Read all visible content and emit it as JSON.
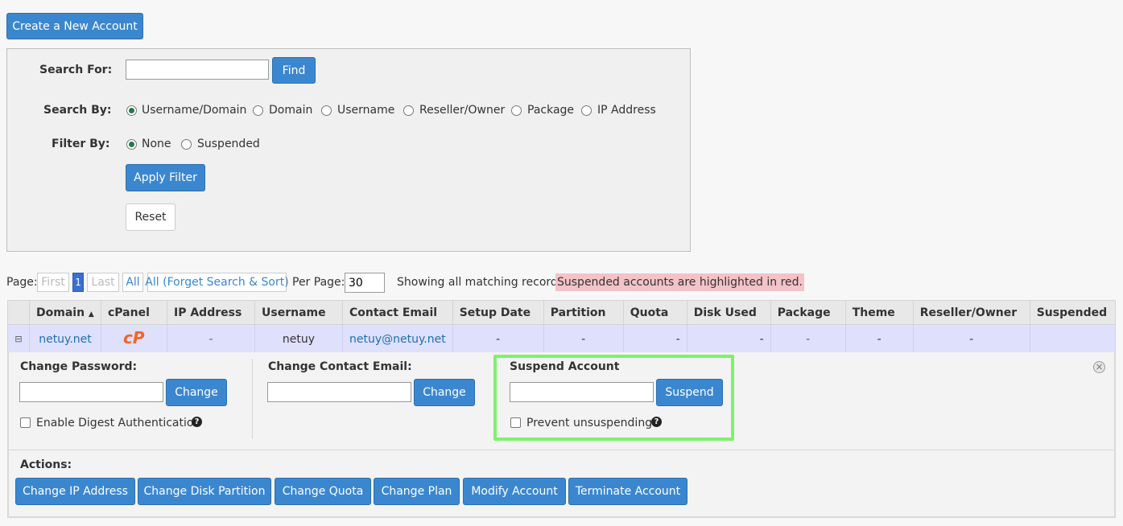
{
  "top": {
    "create_label": "Create a New Account"
  },
  "search": {
    "search_for_label": "Search For:",
    "search_value": "",
    "find_label": "Find",
    "search_by_label": "Search By:",
    "search_by_options": [
      "Username/Domain",
      "Domain",
      "Username",
      "Reseller/Owner",
      "Package",
      "IP Address"
    ],
    "search_by_selected": "Username/Domain",
    "filter_by_label": "Filter By:",
    "filter_options": [
      "None",
      "Suspended"
    ],
    "filter_selected": "None",
    "apply_label": "Apply Filter",
    "reset_label": "Reset"
  },
  "pager": {
    "page_label": "Page:",
    "first": "First",
    "current": "1",
    "last": "Last",
    "all": "All",
    "all_forget": "All (Forget Search & Sort)",
    "per_page_label": "Per Page:",
    "per_page_value": "30",
    "showing_text": "Showing all matching records.",
    "suspended_note": "Suspended accounts are highlighted in red."
  },
  "table": {
    "headers": [
      "Domain",
      "cPanel",
      "IP Address",
      "Username",
      "Contact Email",
      "Setup Date",
      "Partition",
      "Quota",
      "Disk Used",
      "Package",
      "Theme",
      "Reseller/Owner",
      "Suspended"
    ],
    "rows": [
      {
        "expander": "⊟",
        "domain": "netuy.net",
        "ip": "-",
        "username": "netuy",
        "email": "netuy@netuy.net",
        "setup_date": "-",
        "partition": "-",
        "quota": "-",
        "disk_used": "-",
        "package": "-",
        "theme": "-",
        "reseller": "-",
        "suspended": ""
      }
    ]
  },
  "details": {
    "change_password_label": "Change Password:",
    "change_button": "Change",
    "digest_label": "Enable Digest Authentication",
    "change_email_label": "Change Contact Email:",
    "change_email_button": "Change",
    "suspend_label": "Suspend Account",
    "suspend_button": "Suspend",
    "prevent_label": "Prevent unsuspending",
    "actions_label": "Actions:",
    "actions": [
      "Change IP Address",
      "Change Disk Partition",
      "Change Quota",
      "Change Plan",
      "Modify Account",
      "Terminate Account"
    ],
    "help_glyph": "?",
    "close_glyph": "×"
  },
  "colors": {
    "accent": "#3b87cf",
    "row_highlight": "#dfe0fb",
    "suspended_note_bg": "#f4c2c7",
    "focus_outline": "#7cf36b"
  }
}
